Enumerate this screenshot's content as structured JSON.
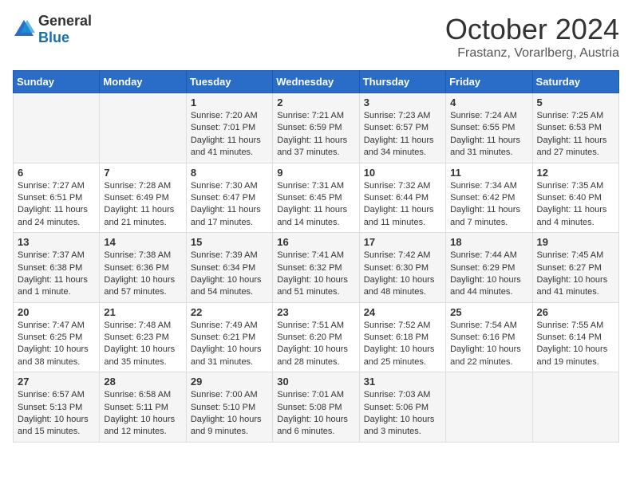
{
  "header": {
    "logo_general": "General",
    "logo_blue": "Blue",
    "month": "October 2024",
    "location": "Frastanz, Vorarlberg, Austria"
  },
  "days_of_week": [
    "Sunday",
    "Monday",
    "Tuesday",
    "Wednesday",
    "Thursday",
    "Friday",
    "Saturday"
  ],
  "weeks": [
    [
      {
        "day": "",
        "info": ""
      },
      {
        "day": "",
        "info": ""
      },
      {
        "day": "1",
        "info": "Sunrise: 7:20 AM\nSunset: 7:01 PM\nDaylight: 11 hours and 41 minutes."
      },
      {
        "day": "2",
        "info": "Sunrise: 7:21 AM\nSunset: 6:59 PM\nDaylight: 11 hours and 37 minutes."
      },
      {
        "day": "3",
        "info": "Sunrise: 7:23 AM\nSunset: 6:57 PM\nDaylight: 11 hours and 34 minutes."
      },
      {
        "day": "4",
        "info": "Sunrise: 7:24 AM\nSunset: 6:55 PM\nDaylight: 11 hours and 31 minutes."
      },
      {
        "day": "5",
        "info": "Sunrise: 7:25 AM\nSunset: 6:53 PM\nDaylight: 11 hours and 27 minutes."
      }
    ],
    [
      {
        "day": "6",
        "info": "Sunrise: 7:27 AM\nSunset: 6:51 PM\nDaylight: 11 hours and 24 minutes."
      },
      {
        "day": "7",
        "info": "Sunrise: 7:28 AM\nSunset: 6:49 PM\nDaylight: 11 hours and 21 minutes."
      },
      {
        "day": "8",
        "info": "Sunrise: 7:30 AM\nSunset: 6:47 PM\nDaylight: 11 hours and 17 minutes."
      },
      {
        "day": "9",
        "info": "Sunrise: 7:31 AM\nSunset: 6:45 PM\nDaylight: 11 hours and 14 minutes."
      },
      {
        "day": "10",
        "info": "Sunrise: 7:32 AM\nSunset: 6:44 PM\nDaylight: 11 hours and 11 minutes."
      },
      {
        "day": "11",
        "info": "Sunrise: 7:34 AM\nSunset: 6:42 PM\nDaylight: 11 hours and 7 minutes."
      },
      {
        "day": "12",
        "info": "Sunrise: 7:35 AM\nSunset: 6:40 PM\nDaylight: 11 hours and 4 minutes."
      }
    ],
    [
      {
        "day": "13",
        "info": "Sunrise: 7:37 AM\nSunset: 6:38 PM\nDaylight: 11 hours and 1 minute."
      },
      {
        "day": "14",
        "info": "Sunrise: 7:38 AM\nSunset: 6:36 PM\nDaylight: 10 hours and 57 minutes."
      },
      {
        "day": "15",
        "info": "Sunrise: 7:39 AM\nSunset: 6:34 PM\nDaylight: 10 hours and 54 minutes."
      },
      {
        "day": "16",
        "info": "Sunrise: 7:41 AM\nSunset: 6:32 PM\nDaylight: 10 hours and 51 minutes."
      },
      {
        "day": "17",
        "info": "Sunrise: 7:42 AM\nSunset: 6:30 PM\nDaylight: 10 hours and 48 minutes."
      },
      {
        "day": "18",
        "info": "Sunrise: 7:44 AM\nSunset: 6:29 PM\nDaylight: 10 hours and 44 minutes."
      },
      {
        "day": "19",
        "info": "Sunrise: 7:45 AM\nSunset: 6:27 PM\nDaylight: 10 hours and 41 minutes."
      }
    ],
    [
      {
        "day": "20",
        "info": "Sunrise: 7:47 AM\nSunset: 6:25 PM\nDaylight: 10 hours and 38 minutes."
      },
      {
        "day": "21",
        "info": "Sunrise: 7:48 AM\nSunset: 6:23 PM\nDaylight: 10 hours and 35 minutes."
      },
      {
        "day": "22",
        "info": "Sunrise: 7:49 AM\nSunset: 6:21 PM\nDaylight: 10 hours and 31 minutes."
      },
      {
        "day": "23",
        "info": "Sunrise: 7:51 AM\nSunset: 6:20 PM\nDaylight: 10 hours and 28 minutes."
      },
      {
        "day": "24",
        "info": "Sunrise: 7:52 AM\nSunset: 6:18 PM\nDaylight: 10 hours and 25 minutes."
      },
      {
        "day": "25",
        "info": "Sunrise: 7:54 AM\nSunset: 6:16 PM\nDaylight: 10 hours and 22 minutes."
      },
      {
        "day": "26",
        "info": "Sunrise: 7:55 AM\nSunset: 6:14 PM\nDaylight: 10 hours and 19 minutes."
      }
    ],
    [
      {
        "day": "27",
        "info": "Sunrise: 6:57 AM\nSunset: 5:13 PM\nDaylight: 10 hours and 15 minutes."
      },
      {
        "day": "28",
        "info": "Sunrise: 6:58 AM\nSunset: 5:11 PM\nDaylight: 10 hours and 12 minutes."
      },
      {
        "day": "29",
        "info": "Sunrise: 7:00 AM\nSunset: 5:10 PM\nDaylight: 10 hours and 9 minutes."
      },
      {
        "day": "30",
        "info": "Sunrise: 7:01 AM\nSunset: 5:08 PM\nDaylight: 10 hours and 6 minutes."
      },
      {
        "day": "31",
        "info": "Sunrise: 7:03 AM\nSunset: 5:06 PM\nDaylight: 10 hours and 3 minutes."
      },
      {
        "day": "",
        "info": ""
      },
      {
        "day": "",
        "info": ""
      }
    ]
  ]
}
